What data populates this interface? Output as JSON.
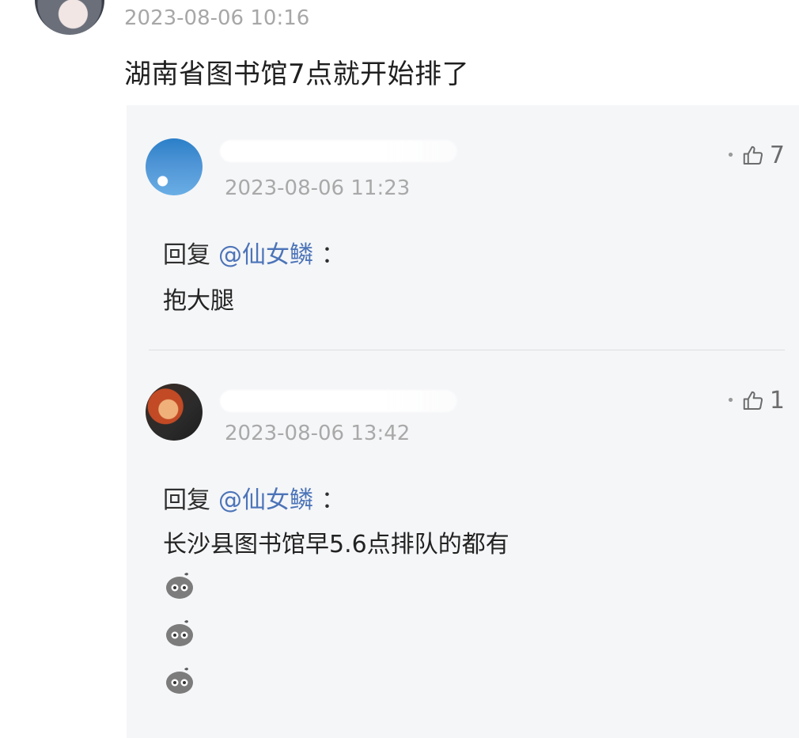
{
  "main_comment": {
    "time": "2023-08-06 10:16",
    "content": "湖南省图书馆7点就开始排了"
  },
  "replies": [
    {
      "time": "2023-08-06 11:23",
      "likes": "7",
      "reply_label": "回复",
      "mention": "@仙女鳞",
      "colon": "：",
      "text": "抱大腿"
    },
    {
      "time": "2023-08-06 13:42",
      "likes": "1",
      "reply_label": "回复",
      "mention": "@仙女鳞",
      "colon": "：",
      "text": "长沙县图书馆早5.6点排队的都有",
      "emojis": [
        "sticker-blob-icon",
        "sticker-blob-icon",
        "sticker-blob-icon"
      ]
    }
  ]
}
